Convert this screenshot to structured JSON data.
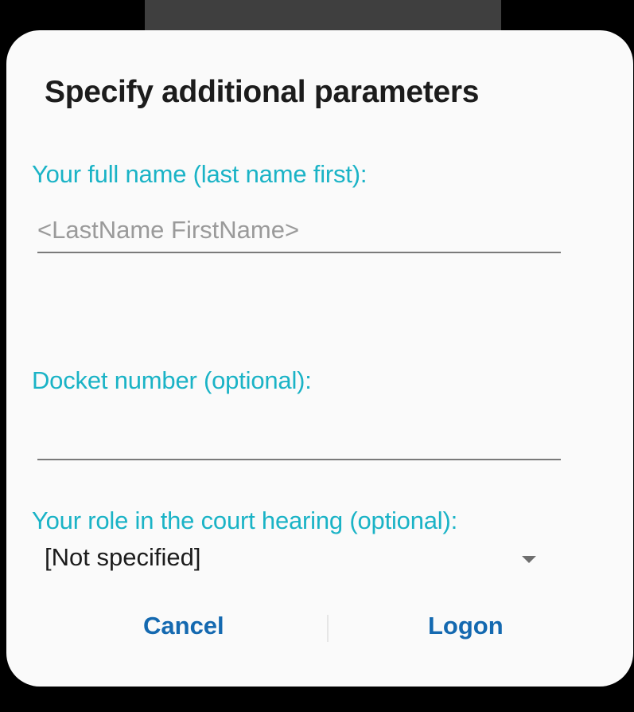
{
  "dialog": {
    "title": "Specify additional parameters",
    "full_name": {
      "label": "Your full name (last name first):",
      "value": "",
      "placeholder": "<LastName FirstName>"
    },
    "docket": {
      "label": "Docket number (optional):",
      "value": "",
      "placeholder": ""
    },
    "role": {
      "label": "Your role in the court hearing (optional):",
      "selected": "[Not specified]"
    },
    "buttons": {
      "cancel": "Cancel",
      "logon": "Logon"
    }
  },
  "colors": {
    "accent_label": "#1ab3c6",
    "button_text": "#1469b0",
    "dialog_bg": "#fafafa"
  }
}
